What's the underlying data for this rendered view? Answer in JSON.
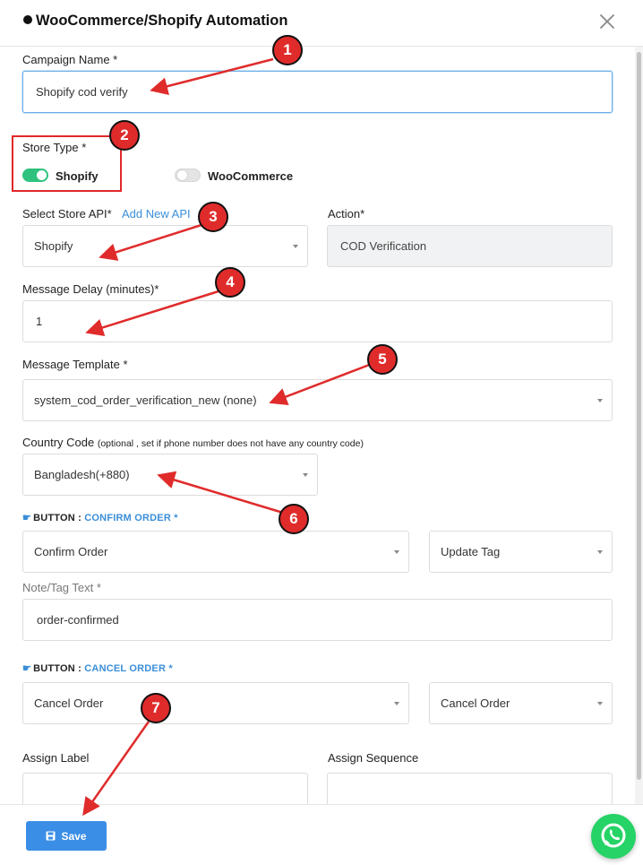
{
  "modal": {
    "title": "WooCommerce/Shopify Automation"
  },
  "campaign": {
    "label": "Campaign Name *",
    "value": "Shopify cod verify"
  },
  "store_type": {
    "label": "Store Type *",
    "options": [
      {
        "label": "Shopify",
        "enabled": true
      },
      {
        "label": "WooCommerce",
        "enabled": false
      }
    ]
  },
  "store_api": {
    "label": "Select Store API*",
    "add_link": "Add New API",
    "value": "Shopify"
  },
  "action": {
    "label": "Action*",
    "value": "COD Verification"
  },
  "delay": {
    "label": "Message Delay (minutes)*",
    "value": "1"
  },
  "template": {
    "label": "Message Template *",
    "value": "system_cod_order_verification_new (none)"
  },
  "country": {
    "label": "Country Code",
    "hint": "(optional , set if phone number does not have any country code)",
    "value": "Bangladesh(+880)"
  },
  "confirm_button": {
    "heading_prefix": "BUTTON :",
    "heading_accent": "CONFIRM ORDER *",
    "action_value": "Confirm Order",
    "secondary_value": "Update Tag",
    "note_label": "Note/Tag Text *",
    "note_value": "order-confirmed"
  },
  "cancel_button": {
    "heading_prefix": "BUTTON :",
    "heading_accent": "CANCEL ORDER *",
    "action_value": "Cancel Order",
    "secondary_value": "Cancel Order"
  },
  "assign": {
    "label_label": "Assign Label",
    "sequence_label": "Assign Sequence"
  },
  "footer": {
    "save_label": "Save"
  },
  "annotations": [
    "1",
    "2",
    "3",
    "4",
    "5",
    "6",
    "7"
  ],
  "colors": {
    "annotation_red": "#e02b2b",
    "primary_blue": "#3a8ee6",
    "toggle_on": "#2ec27e",
    "whatsapp_green": "#25d366"
  }
}
